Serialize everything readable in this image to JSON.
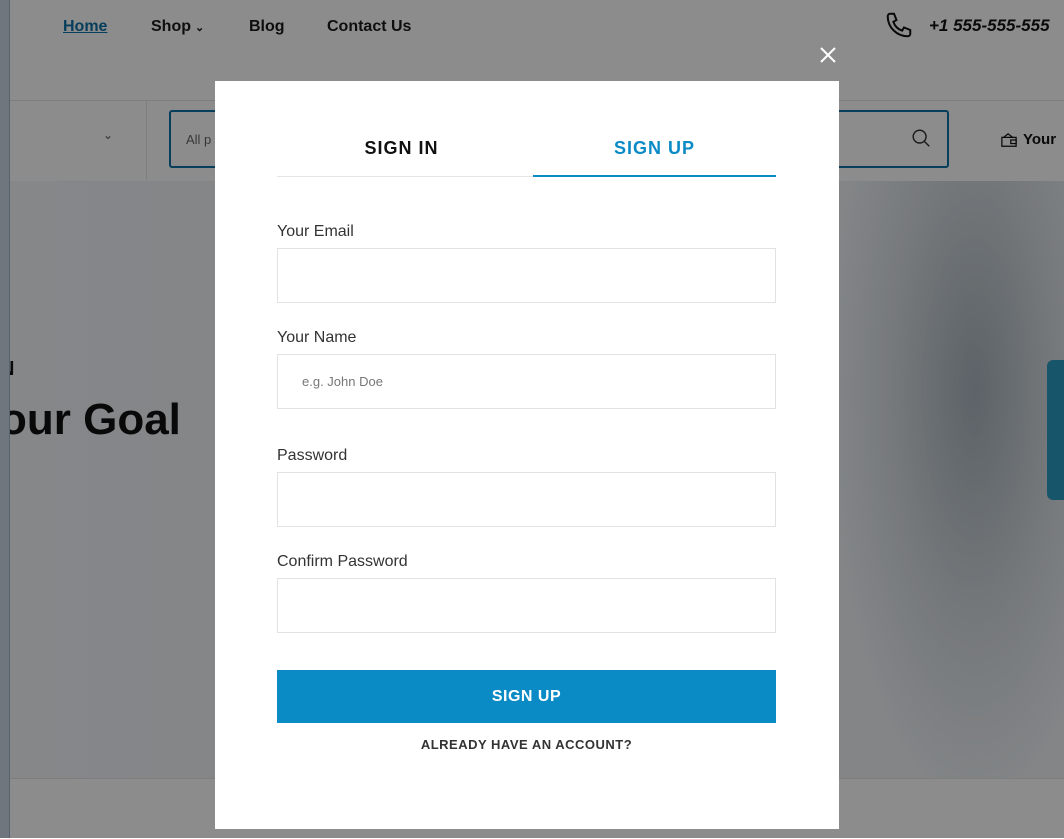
{
  "nav": {
    "home": "Home",
    "shop": "Shop",
    "blog": "Blog",
    "contact": "Contact Us",
    "phone": "+1 555-555-555"
  },
  "search": {
    "placeholder_visible": "All p"
  },
  "cart": {
    "label": "Your"
  },
  "hero": {
    "small_text": "N",
    "title": "our Goal"
  },
  "modal": {
    "close_icon": "close-icon",
    "tabs": {
      "sign_in": "SIGN IN",
      "sign_up": "SIGN UP",
      "active": "sign_up"
    },
    "fields": {
      "email_label": "Your Email",
      "name_label": "Your Name",
      "name_placeholder": "e.g. John Doe",
      "password_label": "Password",
      "confirm_label": "Confirm Password"
    },
    "submit_label": "SIGN UP",
    "alt_link": "ALREADY HAVE AN ACCOUNT?"
  },
  "colors": {
    "accent": "#0b8bc6",
    "link": "#0b71a8",
    "overlay": "rgba(0,0,0,0.45)"
  }
}
